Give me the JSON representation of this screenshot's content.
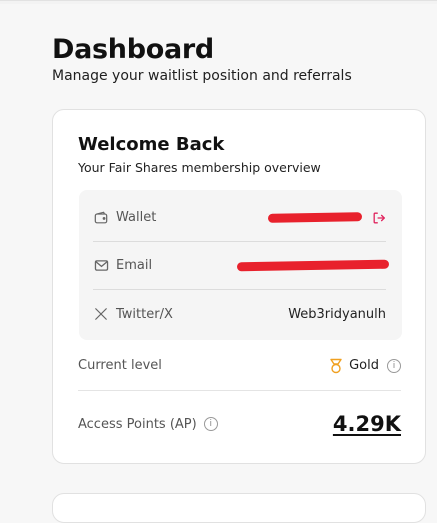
{
  "page": {
    "title": "Dashboard",
    "subtitle": "Manage your waitlist position and referrals"
  },
  "card": {
    "title": "Welcome Back",
    "subtitle": "Your Fair Shares membership overview",
    "rows": [
      {
        "label": "Wallet",
        "icon": "wallet-icon",
        "value": "",
        "redacted": true
      },
      {
        "label": "Email",
        "icon": "mail-icon",
        "value": "",
        "redacted": true
      },
      {
        "label": "Twitter/X",
        "icon": "x-icon",
        "value": "Web3ridyanulh",
        "redacted": false
      }
    ],
    "level": {
      "label": "Current level",
      "value": "Gold",
      "icon": "award-icon"
    },
    "points": {
      "label": "Access Points (AP)",
      "value": "4.29K"
    }
  },
  "colors": {
    "accent": "#e0245e",
    "gold": "#f0a020",
    "redaction": "#e8212c"
  }
}
